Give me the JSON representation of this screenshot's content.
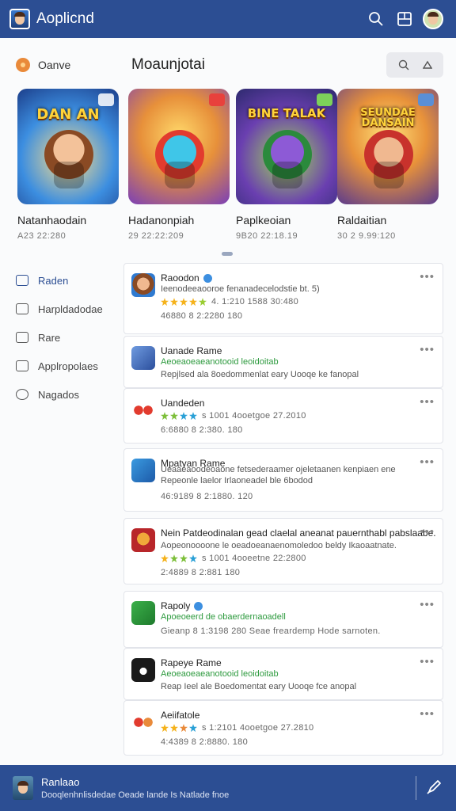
{
  "app": {
    "title": "Aoplicnd"
  },
  "header": {
    "left_label": "Oanve",
    "title": "Moaunjotai"
  },
  "featured": [
    {
      "name": "Natanhaodain",
      "sub": "A23 22:280",
      "banner": "DAN AN"
    },
    {
      "name": "Hadanonpiah",
      "sub": "29 22:22:209",
      "banner": ""
    },
    {
      "name": "Paplkeoian",
      "sub": "9B20 22:18.19",
      "banner": "BINE TALAK"
    },
    {
      "name": "Raldaitian",
      "sub": "30 2 9.99:120",
      "banner": "SEUNDAE DANSAIN"
    }
  ],
  "sidebar": [
    {
      "label": "Raden",
      "icon": "list-icon"
    },
    {
      "label": "Harpldadodae",
      "icon": "image-icon"
    },
    {
      "label": "Rare",
      "icon": "flag-icon"
    },
    {
      "label": "Applropolaes",
      "icon": "briefcase-icon"
    },
    {
      "label": "Nagados",
      "icon": "circle-icon"
    }
  ],
  "apps": [
    {
      "name": "Raoodon",
      "verified": true,
      "desc": "Ieenodeeaooroe fenanadecelodstie bt. 5)",
      "desc_green": false,
      "rating": "4. 1:210 1588 30:480",
      "meta": "46880 8 2:2280 180",
      "more": "•••"
    },
    {
      "name": "Uanade Rame",
      "verified": false,
      "desc": "Aeoeaoeaeanotooid leoidoitab",
      "desc_green": false,
      "desc2": "Repjlsed ala 8oedommenlat eary Uooqe ke fanopal",
      "meta": "",
      "more": "•••"
    },
    {
      "name": "Uandeden",
      "verified": false,
      "desc": "",
      "desc_green": false,
      "rating": "s 1001 4ooetgoe 27.2010",
      "meta": "6:6880 8 2:380. 180",
      "more": "•••"
    },
    {
      "name": "Mpatyan Rame",
      "verified": false,
      "desc": "Ueaaeaoodeoaone fetsederaamer ojeletaanen kenpiaen ene",
      "desc_green": false,
      "desc2": "Repeonle laelor Irlaoneadel ble 6bodod",
      "meta": "46:9189 8 2:1880. 120",
      "more": "•••"
    },
    {
      "name": "Nein Patdeodinalan gead claelal aneanat pauernthabl pabslaabe.",
      "verified": false,
      "desc": "Aopeonoooone le oeadoeanaenomoledoo beldy Ikaoaatnate.",
      "desc_green": false,
      "rating": "s 1001 4ooeetne 22:2800",
      "meta": "2:4889 8 2:881 180",
      "more": "•••"
    },
    {
      "name": "Rapoly",
      "verified": true,
      "desc": "Apoeoeerd de obaerdernaoadell",
      "desc_green": true,
      "meta": "Gieanp 8 1:3198 280 Seae freardemp Hode sarnoten.",
      "more": "•••"
    },
    {
      "name": "Rapeye Rame",
      "verified": false,
      "desc": "Aeoeaoeaeanotooid leoidoitab",
      "desc_green": false,
      "desc2": "Reap Ieel ale Boedomentat eary Uooqe fce anopal",
      "meta": "",
      "more": "•••"
    },
    {
      "name": "Aeiifatole",
      "verified": false,
      "desc": "",
      "desc_green": false,
      "rating": "s 1:2101 4ooetgoe 27.2810",
      "meta": "4:4389 8 2:8880. 180",
      "more": "•••"
    }
  ],
  "bottom": {
    "title": "Ranlaao",
    "links": "Dooqlenhnlisdedae    Oeade lande Is    Natlade fnoe"
  },
  "colors": {
    "primary": "#2c4e93",
    "accent_green": "#2d9a3e",
    "verified_blue": "#3d8fe0"
  }
}
